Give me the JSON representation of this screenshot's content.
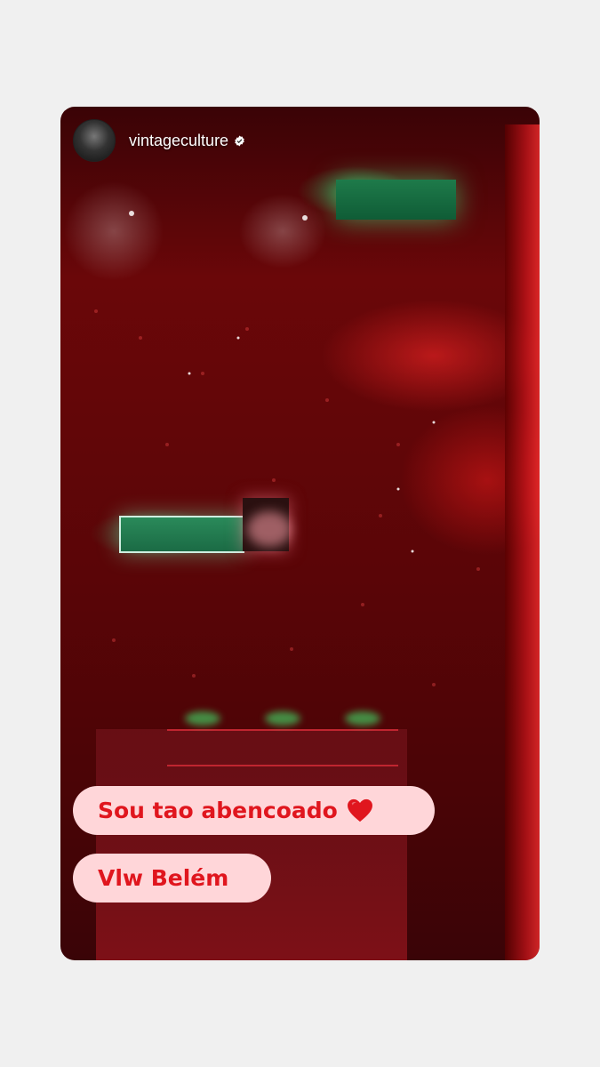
{
  "story": {
    "username": "vintageculture",
    "verified_icon": "verified-badge-icon",
    "captions": [
      {
        "text": "Sou tao abencoado",
        "icon": "red-heart-icon"
      },
      {
        "text": "Vlw Belém"
      }
    ]
  },
  "colors": {
    "page_background": "#f0f0f0",
    "caption_background": "#ffd6d9",
    "caption_text": "#e0161e",
    "heart": "#e0161e"
  }
}
